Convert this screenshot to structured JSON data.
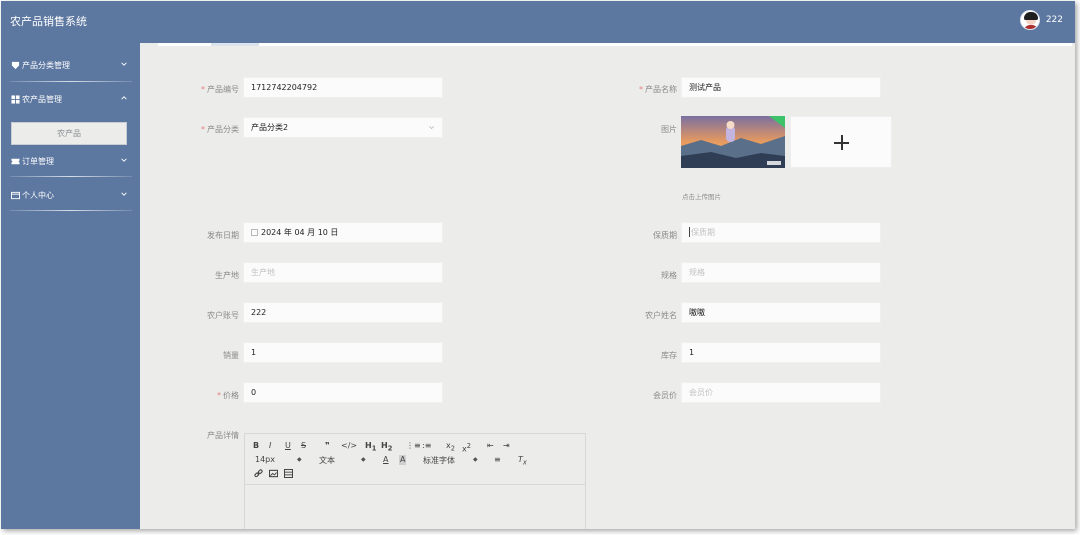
{
  "app": {
    "title": "农产品销售系统"
  },
  "user": {
    "name": "222"
  },
  "sidebar": {
    "items": [
      {
        "label": "产品分类管理",
        "icon": "tag-icon",
        "expanded": false
      },
      {
        "label": "农产品管理",
        "icon": "grid-icon",
        "expanded": true,
        "children": [
          {
            "label": "农产品"
          }
        ]
      },
      {
        "label": "订单管理",
        "icon": "ticket-icon",
        "expanded": false
      },
      {
        "label": "个人中心",
        "icon": "profile-card-icon",
        "expanded": false
      }
    ]
  },
  "form": {
    "product_code": {
      "label": "产品编号",
      "required": true,
      "value": "1712742204792"
    },
    "product_name": {
      "label": "产品名称",
      "required": true,
      "value": "测试产品"
    },
    "category": {
      "label": "产品分类",
      "required": true,
      "value": "产品分类2"
    },
    "image": {
      "label": "图片",
      "hint": "点击上传图片"
    },
    "publish_date": {
      "label": "发布日期",
      "value": "2024 年 04 月 10 日"
    },
    "shelf_life": {
      "label": "保质期",
      "placeholder": "保质期"
    },
    "origin": {
      "label": "生产地",
      "placeholder": "生产地"
    },
    "spec": {
      "label": "规格",
      "placeholder": "规格"
    },
    "farmer_account": {
      "label": "农户账号",
      "value": "222"
    },
    "farmer_name": {
      "label": "农户姓名",
      "value": "嗷嗷"
    },
    "sales": {
      "label": "销量",
      "value": "1"
    },
    "stock": {
      "label": "库存",
      "value": "1"
    },
    "price": {
      "label": "价格",
      "required": true,
      "value": "0"
    },
    "member_price": {
      "label": "会员价",
      "placeholder": "会员价"
    },
    "details": {
      "label": "产品详情",
      "toolbar": {
        "font_size": "14px",
        "block_type": "文本",
        "font_family": "标准字体"
      }
    }
  },
  "colors": {
    "header_bg": "#5c77a0",
    "sidebar_bg": "#5c77a0",
    "content_bg": "#ececea",
    "required_star": "#e27f7f"
  }
}
